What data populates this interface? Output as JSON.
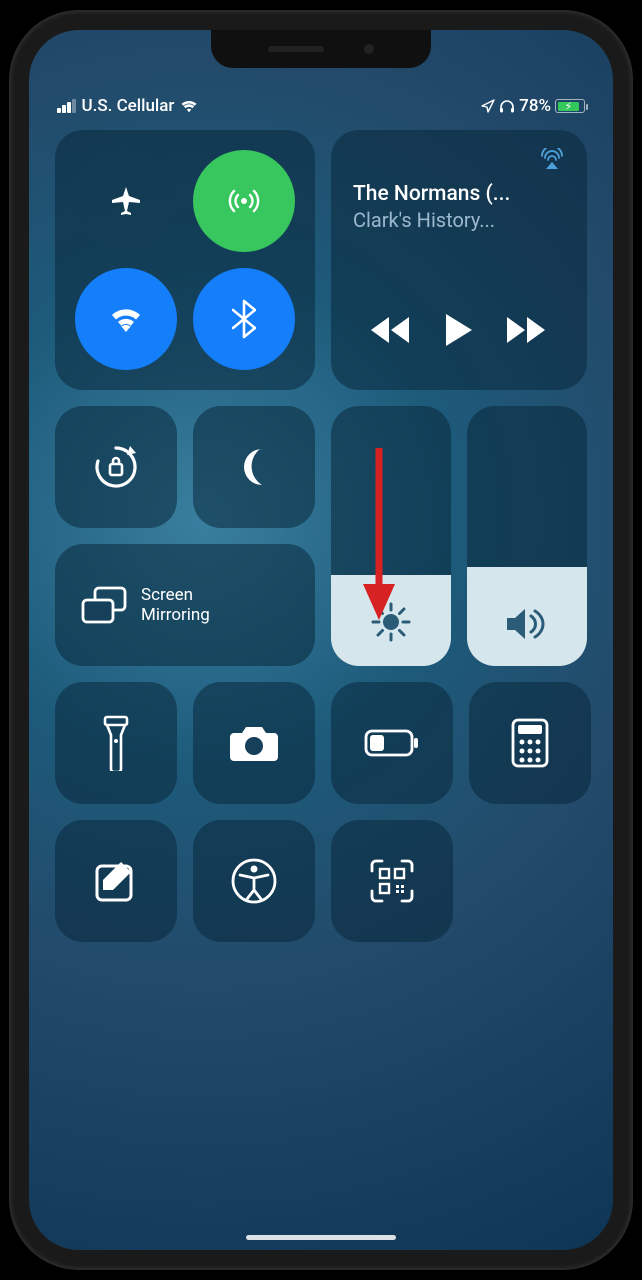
{
  "status": {
    "carrier": "U.S. Cellular",
    "battery_percent_label": "78%",
    "battery_level": 78
  },
  "connectivity": {
    "airplane_on": false,
    "cellular_on": true,
    "wifi_on": true,
    "bluetooth_on": true
  },
  "media": {
    "title": "The Normans (...",
    "subtitle": "Clark's History..."
  },
  "screen_mirroring": {
    "label_line1": "Screen",
    "label_line2": "Mirroring"
  },
  "sliders": {
    "brightness_percent": 35,
    "volume_percent": 38
  },
  "colors": {
    "green": "#38c65e",
    "blue": "#157efb",
    "battery_green": "#34c759",
    "arrow_red": "#d62222"
  }
}
